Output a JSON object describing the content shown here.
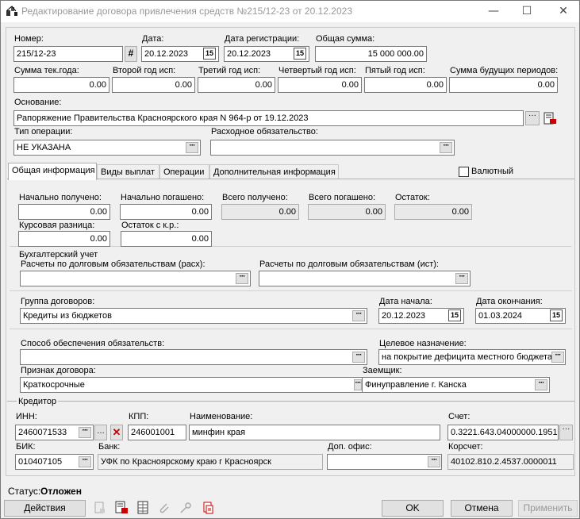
{
  "window": {
    "title": "Редактирование договора привлечения средств №215/12-23 от 20.12.2023"
  },
  "header": {
    "nomer_label": "Номер:",
    "nomer": "215/12-23",
    "data_label": "Дата:",
    "data": "20.12.2023",
    "data_reg_label": "Дата регистрации:",
    "data_reg": "20.12.2023",
    "summa_label": "Общая сумма:",
    "summa": "15 000 000.00"
  },
  "years": [
    {
      "label": "Сумма тек.года:",
      "value": "0.00"
    },
    {
      "label": "Второй год исп:",
      "value": "0.00"
    },
    {
      "label": "Третий год исп:",
      "value": "0.00"
    },
    {
      "label": "Четвертый год исп:",
      "value": "0.00"
    },
    {
      "label": "Пятый год исп:",
      "value": "0.00"
    },
    {
      "label": "Сумма будущих периодов:",
      "value": "0.00"
    }
  ],
  "osnovanie": {
    "label": "Основание:",
    "value": "Рапоряжение Правительства Красноярского края N 964-р от 19.12.2023"
  },
  "tip_operacii": {
    "label": "Тип операции:",
    "value": "НЕ УКАЗАНА"
  },
  "rashod": {
    "label": "Расходное обязательство:",
    "value": ""
  },
  "tabs": [
    "Общая информация",
    "Виды выплат",
    "Операции",
    "Дополнительная информация"
  ],
  "valutny": {
    "label": "Валютный",
    "checked": false
  },
  "info": {
    "nach_poluch_label": "Начально получено:",
    "nach_poluch": "0.00",
    "nach_pogash_label": "Начально погашено:",
    "nach_pogash": "0.00",
    "vsego_poluch_label": "Всего получено:",
    "vsego_poluch": "0.00",
    "vsego_pogash_label": "Всего погашено:",
    "vsego_pogash": "0.00",
    "ostatok_label": "Остаток:",
    "ostatok": "0.00",
    "kurs_label": "Курсовая разница:",
    "kurs": "0.00",
    "ostatok_kr_label": "Остаток с к.р.:",
    "ostatok_kr": "0.00"
  },
  "buh": {
    "title": "Бухгалтерский учет",
    "rash_label": "Расчеты по долговым обязательствам (расх):",
    "rash": "",
    "ist_label": "Расчеты по долговым обязательствам (ист):",
    "ist": ""
  },
  "gruppa": {
    "label": "Группа договоров:",
    "value": "Кредиты из бюджетов"
  },
  "data_nachala": {
    "label": "Дата начала:",
    "value": "20.12.2023"
  },
  "data_okonch": {
    "label": "Дата окончания:",
    "value": "01.03.2024"
  },
  "sposob": {
    "label": "Способ обеспечения обязательств:",
    "value": ""
  },
  "celevoe": {
    "label": "Целевое назначение:",
    "value": "на покрытие дефицита местного бюджета"
  },
  "priznak": {
    "label": "Признак договора:",
    "value": "Краткосрочные"
  },
  "zaemshik": {
    "label": "Заемщик:",
    "value": "Финуправление г. Канска"
  },
  "kreditor": {
    "title": "Кредитор",
    "inn_label": "ИНН:",
    "inn": "2460071533",
    "kpp_label": "КПП:",
    "kpp": "246001001",
    "naim_label": "Наименование:",
    "naim": "минфин края",
    "schet_label": "Счет:",
    "schet": "0.3221.643.04000000.1951",
    "bik_label": "БИК:",
    "bik": "010407105",
    "bank_label": "Банк:",
    "bank": "УФК по Красноярскому краю г Красноярск",
    "dop_label": "Доп. офис:",
    "dop": "",
    "korr_label": "Корсчет:",
    "korr": "40102.810.2.4537.0000011"
  },
  "status": {
    "label": "Статус:",
    "value": "Отложен"
  },
  "buttons": {
    "actions": "Действия",
    "ok": "OK",
    "cancel": "Отмена",
    "apply": "Применить"
  },
  "ellipsis": "···",
  "cal_glyph": "15"
}
